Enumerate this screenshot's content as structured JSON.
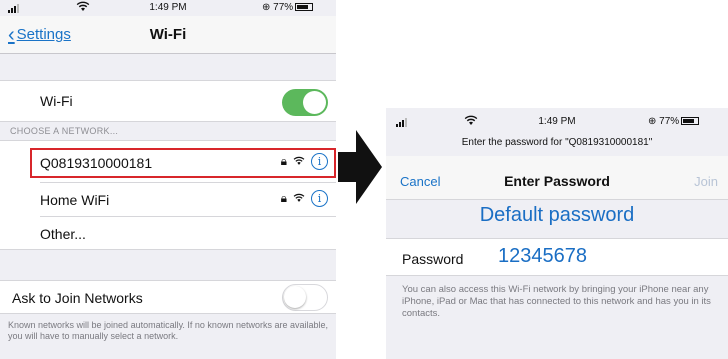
{
  "left_screen": {
    "status_bar": {
      "time": "1:49 PM",
      "battery": "77%"
    },
    "nav": {
      "back_label": "Settings",
      "title": "Wi-Fi"
    },
    "wifi_row": {
      "label": "Wi-Fi",
      "toggle_on": true
    },
    "section_header": "CHOOSE A NETWORK...",
    "networks": [
      {
        "name": "Q0819310000181",
        "locked": true,
        "highlighted": true
      },
      {
        "name": "Home WiFi",
        "locked": true,
        "highlighted": false
      },
      {
        "name": "Other...",
        "locked": false,
        "highlighted": false
      }
    ],
    "ask_to_join": {
      "label": "Ask to Join Networks",
      "toggle_on": false
    },
    "footnote": "Known networks will be joined automatically. If no known networks are available, you will have to manually select a network."
  },
  "right_screen": {
    "status_bar": {
      "time": "1:49 PM",
      "battery": "77%"
    },
    "subtitle": "Enter the password for \"Q0819310000181\"",
    "nav": {
      "cancel_label": "Cancel",
      "title": "Enter Password",
      "join_label": "Join"
    },
    "default_password_label": "Default password",
    "password_field": {
      "label": "Password",
      "value": "12345678"
    },
    "helper_text": "You can also access this Wi-Fi network by bringing your iPhone near any iPhone, iPad or Mac that has connected to this network and has you in its contacts."
  },
  "colors": {
    "accent_blue": "#1a73c7",
    "toggle_green": "#5cb85c",
    "highlight_red": "#d8262b",
    "join_disabled": "#b8c4d6"
  },
  "icons": [
    "signal-icon",
    "wifi-icon",
    "battery-icon",
    "chevron-left-icon",
    "lock-icon",
    "info-icon",
    "arrow-right-icon"
  ]
}
